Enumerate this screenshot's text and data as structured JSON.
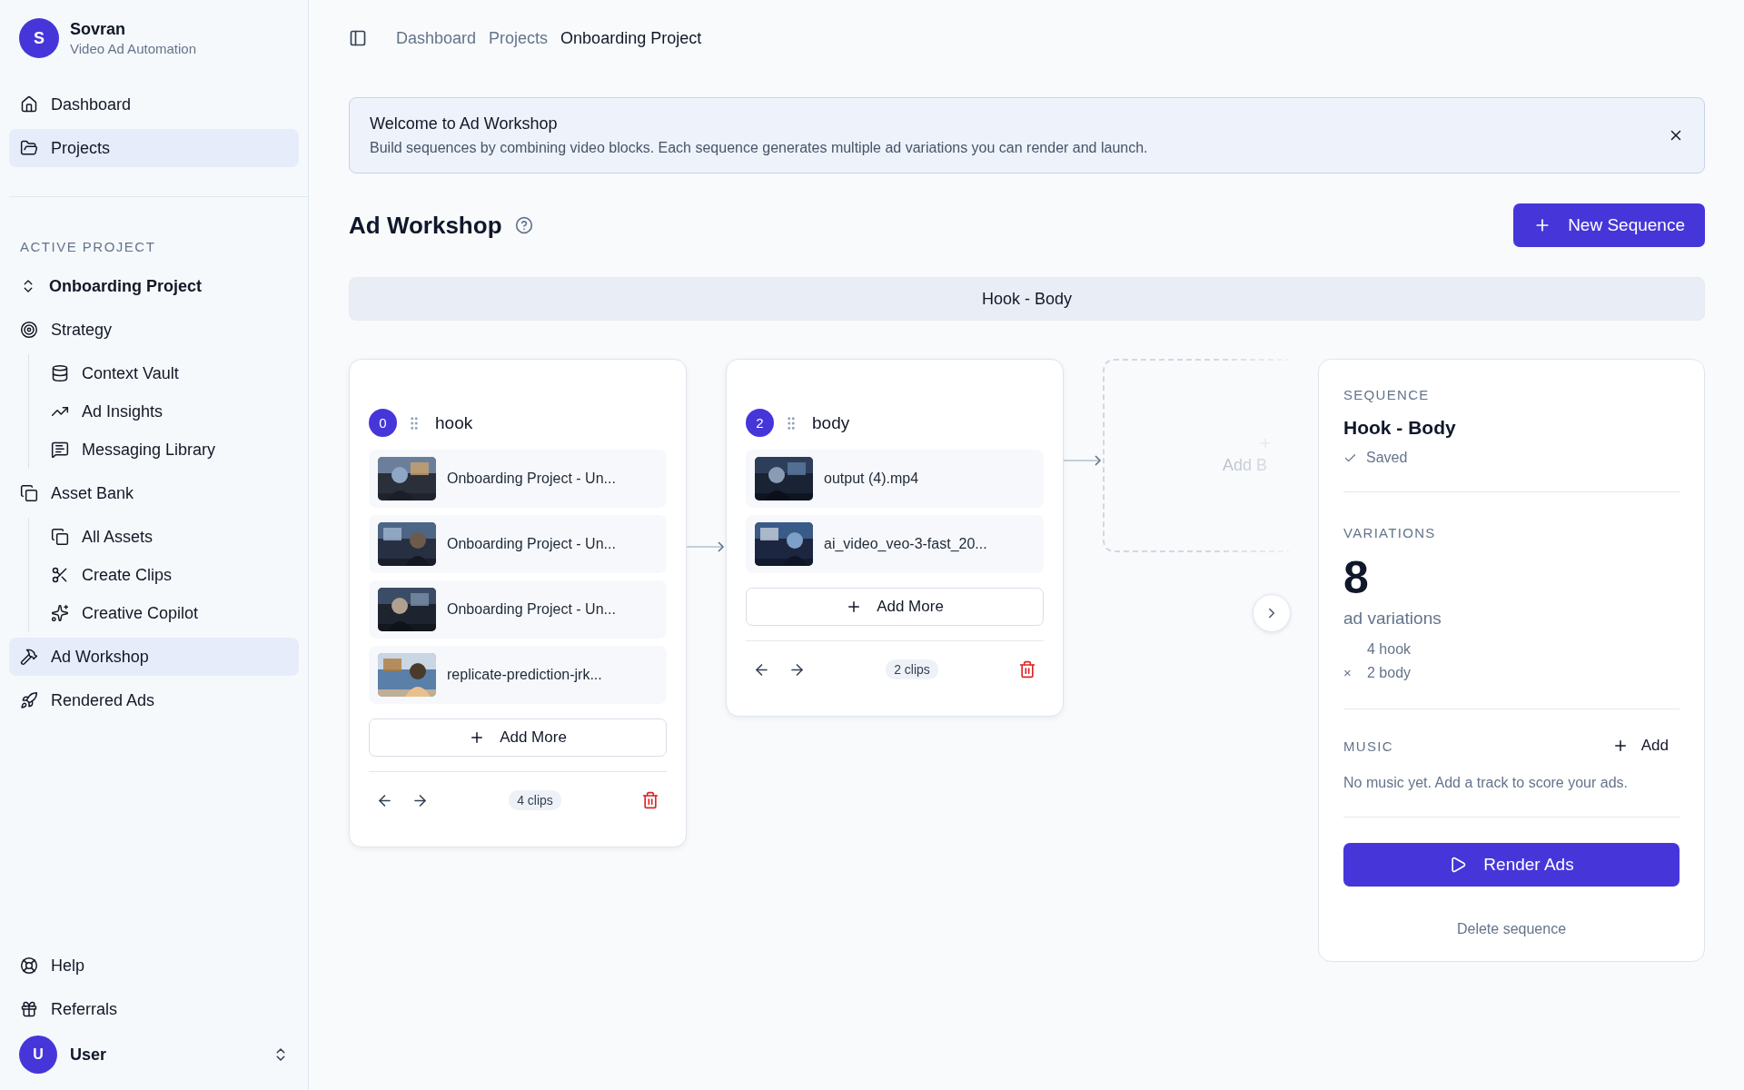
{
  "brand": {
    "initial": "S",
    "name": "Sovran",
    "subtitle": "Video Ad Automation"
  },
  "nav": [
    {
      "label": "Dashboard",
      "selected": false
    },
    {
      "label": "Projects",
      "selected": true
    }
  ],
  "active_project": {
    "heading": "ACTIVE PROJECT",
    "project": "Onboarding Project",
    "items": [
      {
        "label": "Strategy",
        "selected": false,
        "children": [
          {
            "label": "Context Vault",
            "selected": false
          },
          {
            "label": "Ad Insights",
            "selected": false
          },
          {
            "label": "Messaging Library",
            "selected": false
          }
        ]
      },
      {
        "label": "Asset Bank",
        "selected": false,
        "children": [
          {
            "label": "All Assets",
            "selected": false
          },
          {
            "label": "Create Clips",
            "selected": false
          },
          {
            "label": "Creative Copilot",
            "selected": false
          }
        ]
      },
      {
        "label": "Ad Workshop",
        "selected": true
      },
      {
        "label": "Rendered Ads",
        "selected": false
      }
    ]
  },
  "footer_nav": [
    {
      "label": "Help"
    },
    {
      "label": "Referrals"
    }
  ],
  "user": {
    "initial": "U",
    "name": "User"
  },
  "breadcrumbs": [
    {
      "label": "Dashboard",
      "selected": false
    },
    {
      "label": "Projects",
      "selected": false
    },
    {
      "label": "Onboarding Project",
      "selected": true
    }
  ],
  "banner": {
    "title": "Welcome to Ad Workshop",
    "text": "Build sequences by combining video blocks. Each sequence generates multiple ad variations you can render and launch."
  },
  "page": {
    "title": "Ad Workshop",
    "new_button": "New Sequence"
  },
  "sequence_tabs": [
    {
      "label": "Hook - Body",
      "selected": true
    }
  ],
  "blocks": [
    {
      "number": "0",
      "name": "hook",
      "clips": [
        {
          "name": "Onboarding Project - Un..."
        },
        {
          "name": "Onboarding Project - Un..."
        },
        {
          "name": "Onboarding Project - Un..."
        },
        {
          "name": "replicate-prediction-jrk..."
        }
      ],
      "add_label": "Add More",
      "count": "4 clips"
    },
    {
      "number": "2",
      "name": "body",
      "clips": [
        {
          "name": "output (4).mp4"
        },
        {
          "name": "ai_video_veo-3-fast_20..."
        }
      ],
      "add_label": "Add More",
      "count": "2 clips"
    }
  ],
  "ghost_block": {
    "label": "Add B"
  },
  "panel": {
    "sequence_heading": "SEQUENCE",
    "sequence_name": "Hook - Body",
    "status": "Saved",
    "variations_heading": "VARIATIONS",
    "variations_count": "8",
    "variations_label": "ad variations",
    "factors": [
      {
        "text": "4 hook"
      },
      {
        "operator": "×",
        "text": "2 body"
      }
    ],
    "music_heading": "MUSIC",
    "music_add": "Add",
    "music_empty": "No music yet. Add a track to score your ads.",
    "render_button": "Render Ads",
    "delete_link": "Delete sequence"
  }
}
